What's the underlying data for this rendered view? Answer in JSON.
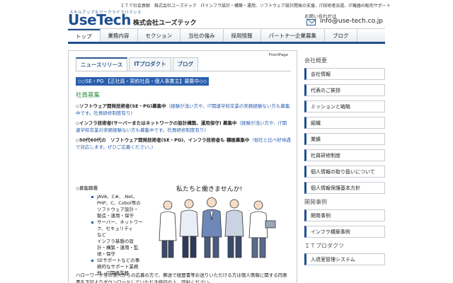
{
  "header": {
    "tagline": "ＩＴで社会貢献　株式会社ユーズテック　ITインフラ設計・構築・運用、ソフトウェア設計開発の支援、IT技術者派遣、IT機器の販売サポート",
    "logo_sub": "スキルアップ＆ワークライフバランス",
    "logo": "UseTech",
    "company": "株式会社ユーズテック",
    "contact_label": "お問い合わせは",
    "contact_email": "info@use-tech.co.jp"
  },
  "nav": {
    "items": [
      "トップ",
      "業務内容",
      "セクション",
      "当社の強み",
      "採用情報",
      "パートナー企業募集",
      "ブログ"
    ]
  },
  "main": {
    "frontpage": "FrontPage",
    "tabs": [
      "ニュースリリース",
      "ITプロダクト",
      "ブログ"
    ],
    "highlight": "◇◇SE・PG 【正社員・契約社員・個人事業主】募集中◇◇",
    "section_title": "社員募集",
    "jobs": [
      {
        "title": "◇ソフトウェア開発技術者(SE・PG)募集中",
        "note": "（経験が浅い方や、IT関連学校卒業の実務経験ない方も募集中です。社員研修制度有り)"
      },
      {
        "title": "◇インフラ技術者(サーバーまたはネットワークの設計構築、運用保守) 募集中",
        "note": "（経験が浅い方や、IT関連学校卒業の実務経験ない方も募集中です。社員研修制度有り)"
      },
      {
        "title": "◇50代60代の　ソフトウェア開発技術者(SE・PG)、インフラ技術者も 積極募集中",
        "note": "（他社と比べ好待遇で対応します。ぜひご応募ください。)"
      }
    ],
    "fields_label": "◇募集職種",
    "field_list": [
      {
        "text": "JAVA、C#、.Net、",
        "bullet": true
      },
      {
        "text": "PHP、C、Cobol等の",
        "bullet": false
      },
      {
        "text": "ソフトウェア設計・",
        "bullet": false
      },
      {
        "text": "製造・運用・保守",
        "bullet": false
      },
      {
        "text": "サーバー、ネットワー",
        "bullet": true
      },
      {
        "text": "ク、セキュリティ",
        "bullet": false
      },
      {
        "text": "など",
        "bullet": false
      },
      {
        "text": "インフラ基盤の設",
        "bullet": false
      },
      {
        "text": "計・構築・運用・監",
        "bullet": false
      },
      {
        "text": "視・保守",
        "bullet": false
      },
      {
        "text": "SEサポートなどの事",
        "bullet": true
      },
      {
        "text": "務的なサポート業務",
        "bullet": false
      },
      {
        "text": "他　IT関連業務",
        "bullet": false
      }
    ],
    "picture_caption": "私たちと働きませんか!",
    "bottom_text": "ハローワーク等の求人からの応募の方で、郵送で経歴書等お送りいただける方は個人情報に関する同意書を下記よりダウンロードしていただき捺印の上、同封ください。"
  },
  "sidebar": {
    "groups": [
      {
        "head": "会社概要",
        "items": [
          "会社情報",
          "代表のご挨拶",
          "ミッションと戦略",
          "組織",
          "業績",
          "社員研修制度",
          "個人情報の取り扱いについて",
          "個人情報保護基本方針"
        ]
      },
      {
        "head": "開発事例",
        "items": [
          "開発事例",
          "インフラ構築事例"
        ]
      },
      {
        "head": "ＩＴプロダクツ",
        "items": [
          "入退室管理システム"
        ]
      }
    ]
  },
  "colors": {
    "brand": "#1f4f8f",
    "highlight": "#2a5fae",
    "section": "#2e8b3e"
  }
}
